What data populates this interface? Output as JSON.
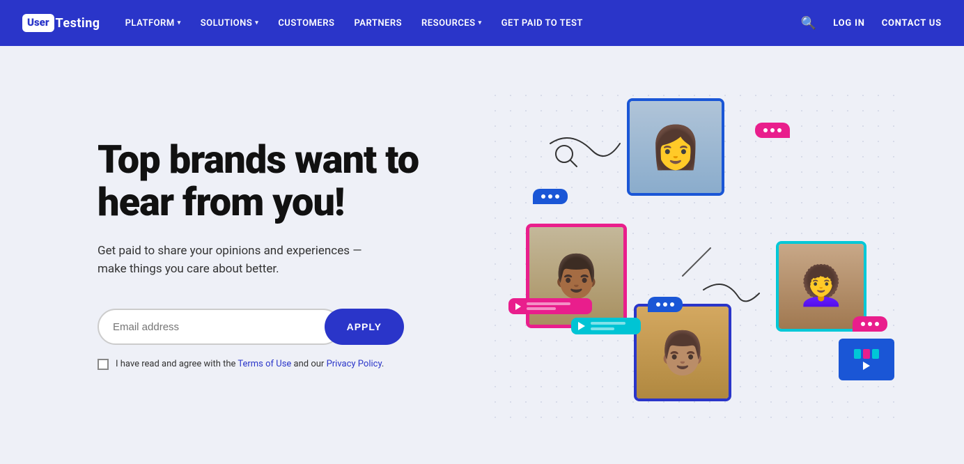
{
  "nav": {
    "logo_user": "User",
    "logo_testing": "Testing",
    "links": [
      {
        "label": "PLATFORM",
        "hasDropdown": true
      },
      {
        "label": "SOLUTIONS",
        "hasDropdown": true
      },
      {
        "label": "CUSTOMERS",
        "hasDropdown": false
      },
      {
        "label": "PARTNERS",
        "hasDropdown": false
      },
      {
        "label": "RESOURCES",
        "hasDropdown": true
      },
      {
        "label": "GET PAID TO TEST",
        "hasDropdown": false
      }
    ],
    "login_label": "LOG IN",
    "contact_label": "CONTACT US"
  },
  "hero": {
    "title": "Top brands want to hear from you!",
    "subtitle": "Get paid to share your opinions and experiences —make things you care about better.",
    "email_placeholder": "Email address",
    "apply_label": "APPLY",
    "terms_text": "I have read and agree with the Terms of Use and our Privacy Policy.",
    "terms_link1": "Terms of Use",
    "terms_link2": "Privacy Policy"
  },
  "colors": {
    "brand_blue": "#2a35c9",
    "pink": "#e91e8c",
    "cyan": "#00c8d7",
    "bubble_blue": "#1a56d6"
  }
}
